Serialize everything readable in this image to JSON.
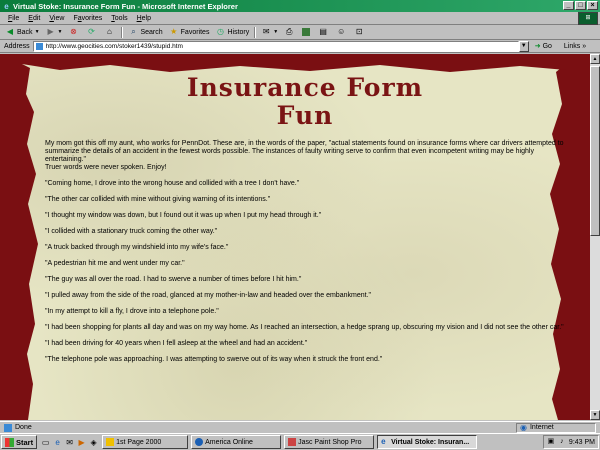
{
  "window": {
    "title": "Virtual Stoke: Insurance Form Fun - Microsoft Internet Explorer",
    "buttons": [
      "_",
      "□",
      "×"
    ]
  },
  "menu": [
    {
      "label": "File",
      "ul": "F",
      "rest": "ile"
    },
    {
      "label": "Edit",
      "ul": "E",
      "rest": "dit"
    },
    {
      "label": "View",
      "ul": "V",
      "rest": "iew"
    },
    {
      "label": "Favorites",
      "ul": "a",
      "pre": "F",
      "rest": "vorites"
    },
    {
      "label": "Tools",
      "ul": "T",
      "rest": "ools"
    },
    {
      "label": "Help",
      "ul": "H",
      "rest": "elp"
    }
  ],
  "toolbar": {
    "back": "Back",
    "search": "Search",
    "favorites": "Favorites",
    "history": "History"
  },
  "address": {
    "label": "Address",
    "url": "http://www.geocities.com/stoker1439/stupid.htm",
    "go": "Go",
    "links": "Links »"
  },
  "page": {
    "title_line1": "Insurance Form",
    "title_line2": "Fun",
    "intro": "My mom got this off my aunt, who works for PennDot. These are, in the words of the paper, \"actual statements found on insurance forms where car drivers attempted to summarize the details of an accident in the fewest words possible. The instances of faulty writing serve to confirm that even incompetent writing may be highly entertaining.\"",
    "intro2": "Truer words were never spoken. Enjoy!",
    "quotes": [
      "\"Coming home, I drove into the wrong house and collided with a tree I don't have.\"",
      "\"The other car collided with mine without giving warning of its intentions.\"",
      "\"I thought my window was down, but I found out it was up when I put my head through it.\"",
      "\"I collided with a stationary truck coming the other way.\"",
      "\"A truck backed through my windshield into my wife's face.\"",
      "\"A pedestrian hit me and went under my car.\"",
      "\"The guy was all over the road. I had to swerve a number of times before I hit him.\"",
      "\"I pulled away from the side of the road, glanced at my mother-in-law and headed over the embankment.\"",
      "\"In my attempt to kill a fly, I drove into a telephone pole.\"",
      "\"I had been shopping for plants all day and was on my way home. As I reached an intersection, a hedge sprang up, obscuring my vision and I did not see the other car.\"",
      "\"I had been driving for 40 years when I fell asleep at the wheel and had an accident.\"",
      "\"The telephone pole was approaching. I was attempting to swerve out of its way when it struck the front end.\""
    ]
  },
  "status": {
    "text": "Done",
    "zone": "Internet"
  },
  "taskbar": {
    "start": "Start",
    "tasks": [
      {
        "label": "1st Page 2000",
        "active": false
      },
      {
        "label": "America Online",
        "active": false
      },
      {
        "label": "Jasc Paint Shop Pro",
        "active": false
      },
      {
        "label": "Virtual Stoke: Insuran...",
        "active": true
      }
    ],
    "time": "9:43 PM"
  },
  "colors": {
    "titlebar": "#0a7c3c",
    "border_red": "#7a0f12",
    "parchment": "#e6e5c4",
    "heading": "#7a1414"
  }
}
